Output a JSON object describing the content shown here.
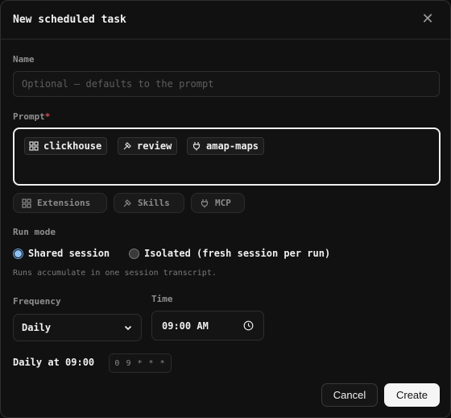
{
  "dialog": {
    "title": "New scheduled task",
    "close_icon": "close-icon"
  },
  "name": {
    "label": "Name",
    "value": "",
    "placeholder": "Optional — defaults to the prompt"
  },
  "prompt": {
    "label": "Prompt",
    "required_mark": "*",
    "chips": [
      {
        "label": "clickhouse",
        "icon": "extension-icon"
      },
      {
        "label": "review",
        "icon": "skill-icon"
      },
      {
        "label": "amap-maps",
        "icon": "plug-icon"
      }
    ]
  },
  "tools": [
    {
      "label": "Extensions",
      "icon": "extension-icon"
    },
    {
      "label": "Skills",
      "icon": "skill-icon"
    },
    {
      "label": "MCP",
      "icon": "plug-icon"
    }
  ],
  "run_mode": {
    "label": "Run mode",
    "options": [
      {
        "label": "Shared session",
        "selected": true
      },
      {
        "label": "Isolated (fresh session per run)",
        "selected": false
      }
    ],
    "hint": "Runs accumulate in one session transcript."
  },
  "frequency": {
    "label": "Frequency",
    "value": "Daily"
  },
  "time": {
    "label": "Time",
    "value": "09:00 AM"
  },
  "schedule": {
    "summary": "Daily at 09:00",
    "cron": "0 9 * * *"
  },
  "actions": {
    "cancel_label": "Cancel",
    "create_label": "Create"
  },
  "colors": {
    "background": "#111111",
    "required": "#e5484d",
    "radio_accent": "#8ec0f5",
    "primary_button": "#f5f5f5"
  }
}
